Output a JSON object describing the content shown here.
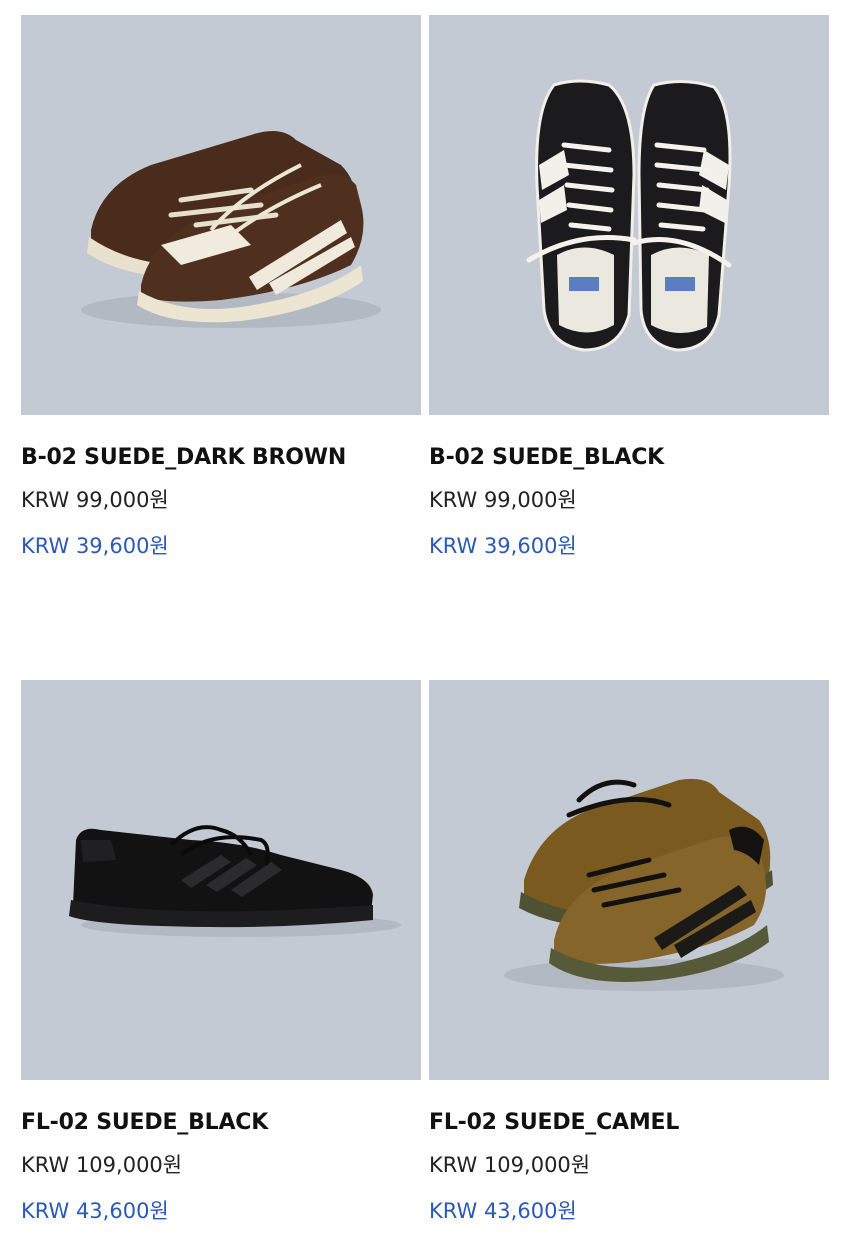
{
  "products": [
    {
      "name": "B-02 SUEDE_DARK BROWN",
      "price": "KRW 99,000원",
      "sale_price": "KRW 39,600원",
      "image_icon": "sneaker-photo"
    },
    {
      "name": "B-02 SUEDE_BLACK",
      "price": "KRW 99,000원",
      "sale_price": "KRW 39,600원",
      "image_icon": "sneaker-photo"
    },
    {
      "name": "FL-02 SUEDE_BLACK",
      "price": "KRW 109,000원",
      "sale_price": "KRW 43,600원",
      "image_icon": "sneaker-photo"
    },
    {
      "name": "FL-02 SUEDE_CAMEL",
      "price": "KRW 109,000원",
      "sale_price": "KRW 43,600원",
      "image_icon": "sneaker-photo"
    }
  ],
  "colors": {
    "photo_background": "#c4cad3",
    "sale_price": "#2a59b8",
    "text": "#111111"
  }
}
